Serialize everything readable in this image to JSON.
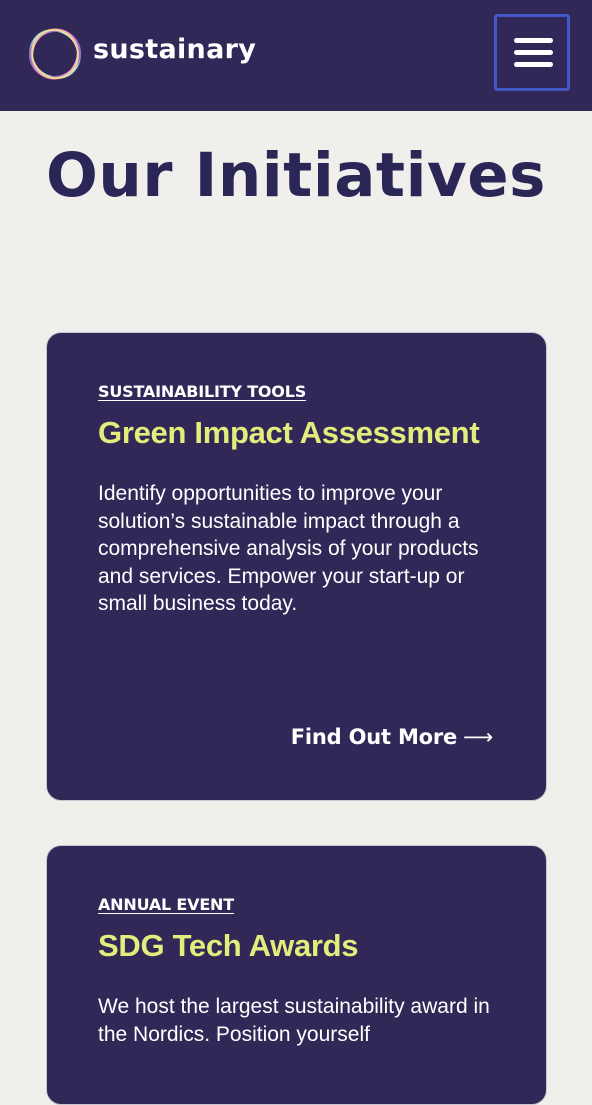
{
  "header": {
    "brand_name": "sustainary",
    "menu_icon": "hamburger-menu-icon",
    "logo_icon": "multicolor-ring-logo"
  },
  "page": {
    "title": "Our Initiatives"
  },
  "colors": {
    "header_bg": "#312858",
    "page_bg": "#f0efeb",
    "title_color": "#2a2656",
    "card_bg": "#312858",
    "card_title_color": "#e4ec7c",
    "menu_focus_outline": "#4257c4"
  },
  "initiatives": [
    {
      "eyebrow": "SUSTAINABILITY TOOLS",
      "title": "Green Impact Assessment",
      "description": "Identify opportunities to improve your solution’s sustainable impact through a comprehensive  analysis of your products and services. Empower your start-up or small business today.",
      "link_label": "Find Out More",
      "link_arrow": "⟶"
    },
    {
      "eyebrow": "ANNUAL EVENT",
      "title": "SDG Tech Awards",
      "description": "We host the largest sustainability award in the Nordics. Position yourself"
    }
  ]
}
